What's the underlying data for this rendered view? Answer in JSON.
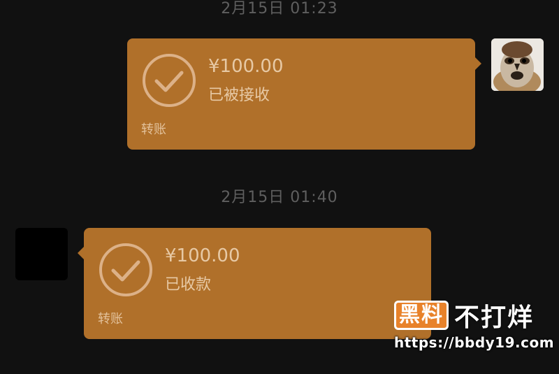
{
  "conversation": {
    "messages": [
      {
        "timestamp": "2月15日 01:23",
        "sender": "self",
        "amount": "¥100.00",
        "status": "已被接收",
        "type": "转账"
      },
      {
        "timestamp": "2月15日 01:40",
        "sender": "other",
        "amount": "¥100.00",
        "status": "已收款",
        "type": "转账"
      }
    ]
  },
  "colors": {
    "background": "#111111",
    "card": "#b0702a",
    "card_text": "#e7c9a5",
    "timestamp": "#5f5f5f"
  },
  "watermark": {
    "logo_text": "黑料",
    "tagline": "不打烊",
    "url": "https://bbdy19.com"
  },
  "icons": {
    "transfer_status": "check-circle-icon",
    "self_avatar": "sparrow-avatar",
    "other_avatar": "black-avatar"
  }
}
